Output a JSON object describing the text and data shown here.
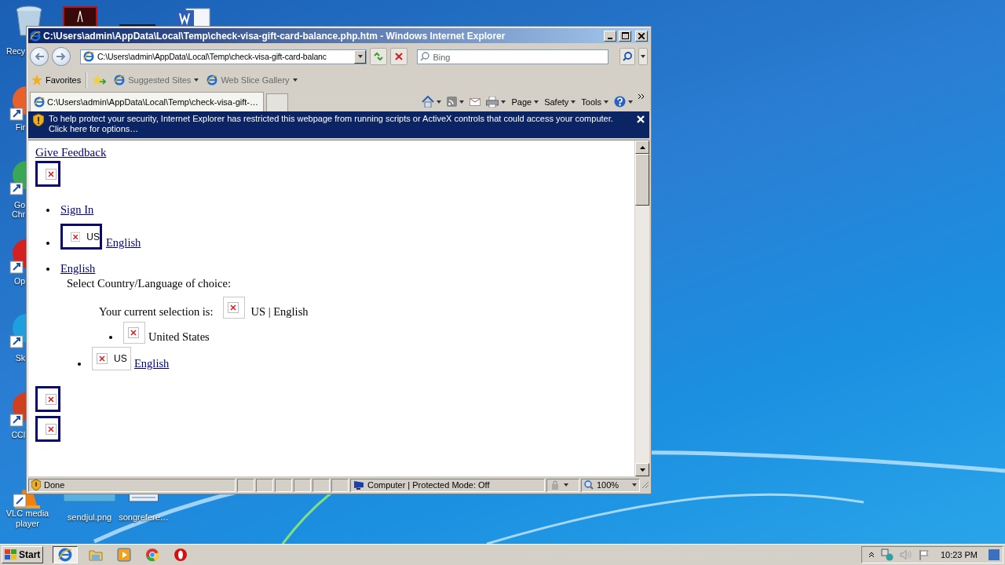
{
  "desktop": {
    "top_icons": [
      {
        "kind": "recycle"
      },
      {
        "kind": "pdf"
      },
      {
        "kind": "dark"
      },
      {
        "kind": "word"
      }
    ],
    "side_icons": [
      {
        "kind": "firefox",
        "label": [
          "Fir"
        ]
      },
      {
        "kind": "chrome",
        "label": [
          "Go",
          "Chr"
        ]
      },
      {
        "kind": "opera",
        "label": [
          "Op"
        ]
      },
      {
        "kind": "skype",
        "label": [
          "Sk"
        ]
      },
      {
        "kind": "ccleaner",
        "label": [
          "CCl"
        ]
      }
    ],
    "recycle_label": "Recy",
    "bottom_icons": [
      {
        "kind": "vlc",
        "label": "VLC media player"
      },
      {
        "kind": "image",
        "label": "sendjul.png"
      },
      {
        "kind": "doc",
        "label": "songrefere…"
      }
    ]
  },
  "window": {
    "title": "C:\\Users\\admin\\AppData\\Local\\Temp\\check-visa-gift-card-balance.php.htm - Windows Internet Explorer",
    "address": "C:\\Users\\admin\\AppData\\Local\\Temp\\check-visa-gift-card-balanc",
    "search": {
      "placeholder": "Bing"
    },
    "favorites": "Favorites",
    "favorite_links": [
      "Suggested Sites",
      "Web Slice Gallery"
    ],
    "tab": {
      "title": "C:\\Users\\admin\\AppData\\Local\\Temp\\check-visa-gift-…",
      "selected": true
    },
    "commands": [
      "Page",
      "Safety",
      "Tools"
    ],
    "info_bar": "To help protect your security, Internet Explorer has restricted this webpage from running scripts or ActiveX controls that could access your computer. Click here for options…",
    "page": {
      "feedback": "Give Feedback",
      "sign_in": "Sign In",
      "flag_badge": "US",
      "flag_link": "English",
      "language_link": "English",
      "prompt": "Select Country/Language of choice:",
      "current_label": "Your current selection is:",
      "current_value": "US | English",
      "country": "United States",
      "option_badge": "US",
      "option_link": "English"
    },
    "status": "Done",
    "zone": "Computer | Protected Mode: Off",
    "zoom": "100%"
  },
  "taskbar": {
    "start": "Start",
    "apps": [
      {
        "kind": "ie",
        "selected": true
      },
      {
        "kind": "explorer",
        "selected": false
      },
      {
        "kind": "media",
        "selected": false
      },
      {
        "kind": "chrome",
        "selected": false
      },
      {
        "kind": "opera",
        "selected": false
      }
    ],
    "clock": "10:23 PM"
  }
}
